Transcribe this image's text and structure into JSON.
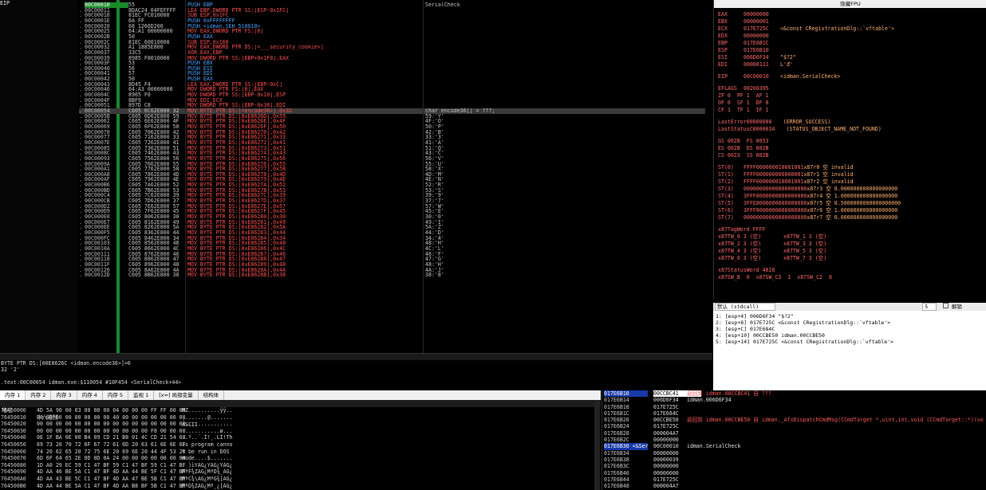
{
  "cpu": {
    "eip_label": "EIP",
    "rows": [
      {
        "addr": "00C00010",
        "hex": "55",
        "dis": "PUSH EBP",
        "cmt": "SerialCheck",
        "kind": "push",
        "sel": false,
        "cur": true
      },
      {
        "addr": "00C00011",
        "hex": "8DAC24 04FEFFFF",
        "dis": "LEA EBP,DWORD PTR SS:[ESP-0x1FC]",
        "cmt": "",
        "kind": "mov"
      },
      {
        "addr": "00C00018",
        "hex": "81EC FC010000",
        "dis": "SUB ESP,0x1FC",
        "cmt": "",
        "kind": "mov"
      },
      {
        "addr": "00C0001E",
        "hex": "6A FF",
        "dis": "PUSH 0xFFFFFFFF",
        "cmt": "",
        "kind": "push"
      },
      {
        "addr": "00C00020",
        "hex": "68 1266D200",
        "dis": "PUSH <idman.SEH_510010>",
        "cmt": "",
        "kind": "push"
      },
      {
        "addr": "00C00025",
        "hex": "64:A1 00000000",
        "dis": "MOV EAX,DWORD PTR FS:[0]",
        "cmt": "",
        "kind": "mov"
      },
      {
        "addr": "00C0002B",
        "hex": "50",
        "dis": "PUSH EAX",
        "cmt": "",
        "kind": "push"
      },
      {
        "addr": "00C0002C",
        "hex": "81EC 60010000",
        "dis": "SUB ESP,0x160",
        "cmt": "",
        "kind": "mov"
      },
      {
        "addr": "00C00032",
        "hex": "A1 1885E800",
        "dis": "MOV EAX,DWORD PTR DS:[<___security_cookie>]",
        "cmt": "",
        "kind": "mov"
      },
      {
        "addr": "00C00037",
        "hex": "33C5",
        "dis": "XOR EAX,EBP",
        "cmt": "",
        "kind": "mov"
      },
      {
        "addr": "00C00039",
        "hex": "8985 F8010000",
        "dis": "MOV DWORD PTR SS:[EBP+0x1F8],EAX",
        "cmt": "",
        "kind": "mov"
      },
      {
        "addr": "00C0003F",
        "hex": "53",
        "dis": "PUSH EBX",
        "cmt": "",
        "kind": "push"
      },
      {
        "addr": "00C00040",
        "hex": "56",
        "dis": "PUSH ESI",
        "cmt": "",
        "kind": "push"
      },
      {
        "addr": "00C00041",
        "hex": "57",
        "dis": "PUSH EDI",
        "cmt": "",
        "kind": "push"
      },
      {
        "addr": "00C00042",
        "hex": "50",
        "dis": "PUSH EAX",
        "cmt": "",
        "kind": "push"
      },
      {
        "addr": "00C00043",
        "hex": "8D45 F4",
        "dis": "LEA EAX,DWORD PTR SS:[EBP-0xC]",
        "cmt": "",
        "kind": "mov"
      },
      {
        "addr": "00C00046",
        "hex": "64:A3 00000000",
        "dis": "MOV DWORD PTR FS:[0],EAX",
        "cmt": "",
        "kind": "mov"
      },
      {
        "addr": "00C0004C",
        "hex": "8965 F0",
        "dis": "MOV DWORD PTR SS:[EBP-0x10],ESP",
        "cmt": "",
        "kind": "mov"
      },
      {
        "addr": "00C0004F",
        "hex": "8BF9",
        "dis": "MOV EDI,ECX",
        "cmt": "",
        "kind": "mov"
      },
      {
        "addr": "00C00051",
        "hex": "897D C8",
        "dis": "MOV DWORD PTR SS:[EBP-0x38],EDI",
        "cmt": "",
        "kind": "mov"
      },
      {
        "addr": "00C00054",
        "hex": "C605 6C62E800 32",
        "dis": "MOV BYTE PTR DS:[<encode36>],0x32",
        "cmt": "char encode36[] = ???;",
        "kind": "mov",
        "sel": true
      },
      {
        "addr": "00C0005B",
        "hex": "C605 6D62E800 59",
        "dis": "MOV BYTE PTR DS:[0xE8626D],0x59",
        "cmt": "59:'Y'",
        "kind": "mov"
      },
      {
        "addr": "00C00062",
        "hex": "C605 6E62E800 4F",
        "dis": "MOV BYTE PTR DS:[0xE8626E],0x4F",
        "cmt": "4F:'O'",
        "kind": "mov"
      },
      {
        "addr": "00C00069",
        "hex": "C605 6F62E800 50",
        "dis": "MOV BYTE PTR DS:[0xE8626F],0x50",
        "cmt": "50:'P'",
        "kind": "mov"
      },
      {
        "addr": "00C00070",
        "hex": "C605 7062E800 42",
        "dis": "MOV BYTE PTR DS:[0xE86270],0x42",
        "cmt": "42:'B'",
        "kind": "mov"
      },
      {
        "addr": "00C00077",
        "hex": "C605 7162E800 33",
        "dis": "MOV BYTE PTR DS:[0xE86271],0x33",
        "cmt": "33:'3'",
        "kind": "mov"
      },
      {
        "addr": "00C0007E",
        "hex": "C605 7262E800 41",
        "dis": "MOV BYTE PTR DS:[0xE86272],0x41",
        "cmt": "41:'A'",
        "kind": "mov"
      },
      {
        "addr": "00C00085",
        "hex": "C605 7362E800 51",
        "dis": "MOV BYTE PTR DS:[0xE86273],0x51",
        "cmt": "51:'Q'",
        "kind": "mov"
      },
      {
        "addr": "00C0008C",
        "hex": "C605 7462E800 43",
        "dis": "MOV BYTE PTR DS:[0xE86274],0x43",
        "cmt": "43:'C'",
        "kind": "mov"
      },
      {
        "addr": "00C00093",
        "hex": "C605 7562E800 56",
        "dis": "MOV BYTE PTR DS:[0xE86275],0x56",
        "cmt": "56:'V'",
        "kind": "mov"
      },
      {
        "addr": "00C0009A",
        "hex": "C605 7662E800 55",
        "dis": "MOV BYTE PTR DS:[0xE86276],0x55",
        "cmt": "55:'U'",
        "kind": "mov"
      },
      {
        "addr": "00C000A1",
        "hex": "C605 7762E800 58",
        "dis": "MOV BYTE PTR DS:[0xE86277],0x58",
        "cmt": "58:'X'",
        "kind": "mov"
      },
      {
        "addr": "00C000A8",
        "hex": "C605 7862E800 4D",
        "dis": "MOV BYTE PTR DS:[0xE86278],0x4D",
        "cmt": "4D:'M'",
        "kind": "mov"
      },
      {
        "addr": "00C000AF",
        "hex": "C605 7962E800 4E",
        "dis": "MOV BYTE PTR DS:[0xE86279],0x4E",
        "cmt": "4E:'N'",
        "kind": "mov"
      },
      {
        "addr": "00C000B6",
        "hex": "C605 7A62E800 52",
        "dis": "MOV BYTE PTR DS:[0xE8627A],0x52",
        "cmt": "52:'R'",
        "kind": "mov"
      },
      {
        "addr": "00C000BD",
        "hex": "C605 7B62E800 53",
        "dis": "MOV BYTE PTR DS:[0xE8627B],0x53",
        "cmt": "53:'S'",
        "kind": "mov"
      },
      {
        "addr": "00C000C4",
        "hex": "C605 7C62E800 39",
        "dis": "MOV BYTE PTR DS:[0xE8627C],0x39",
        "cmt": "39:'9'",
        "kind": "mov"
      },
      {
        "addr": "00C000CB",
        "hex": "C605 7D62E800 37",
        "dis": "MOV BYTE PTR DS:[0xE8627D],0x37",
        "cmt": "37:'7'",
        "kind": "mov"
      },
      {
        "addr": "00C000D2",
        "hex": "C605 7E62E800 57",
        "dis": "MOV BYTE PTR DS:[0xE8627E],0x57",
        "cmt": "57:'W'",
        "kind": "mov"
      },
      {
        "addr": "00C000D9",
        "hex": "C605 7F62E800 45",
        "dis": "MOV BYTE PTR DS:[0xE8627F],0x45",
        "cmt": "45:'E'",
        "kind": "mov"
      },
      {
        "addr": "00C000E0",
        "hex": "C605 8062E800 30",
        "dis": "MOV BYTE PTR DS:[0xE86280],0x30",
        "cmt": "30:'0'",
        "kind": "mov"
      },
      {
        "addr": "00C000E7",
        "hex": "C605 8162E800 49",
        "dis": "MOV BYTE PTR DS:[0xE86281],0x49",
        "cmt": "49:'I'",
        "kind": "mov"
      },
      {
        "addr": "00C000EE",
        "hex": "C605 8262E800 5A",
        "dis": "MOV BYTE PTR DS:[0xE86282],0x5A",
        "cmt": "5A:'Z'",
        "kind": "mov"
      },
      {
        "addr": "00C000F5",
        "hex": "C605 8362E800 44",
        "dis": "MOV BYTE PTR DS:[0xE86283],0x44",
        "cmt": "44:'D'",
        "kind": "mov"
      },
      {
        "addr": "00C000FC",
        "hex": "C605 8462E800 34",
        "dis": "MOV BYTE PTR DS:[0xE86284],0x34",
        "cmt": "34:'4'",
        "kind": "mov"
      },
      {
        "addr": "00C00103",
        "hex": "C605 8562E800 48",
        "dis": "MOV BYTE PTR DS:[0xE86285],0x48",
        "cmt": "48:'H'",
        "kind": "mov"
      },
      {
        "addr": "00C0010A",
        "hex": "C605 8662E800 4C",
        "dis": "MOV BYTE PTR DS:[0xE86286],0x4C",
        "cmt": "4C:'L'",
        "kind": "mov"
      },
      {
        "addr": "00C00111",
        "hex": "C605 8762E800 46",
        "dis": "MOV BYTE PTR DS:[0xE86287],0x46",
        "cmt": "46:'F'",
        "kind": "mov"
      },
      {
        "addr": "00C00118",
        "hex": "C605 8862E800 47",
        "dis": "MOV BYTE PTR DS:[0xE86288],0x47",
        "cmt": "47:'G'",
        "kind": "mov"
      },
      {
        "addr": "00C0011F",
        "hex": "C605 8962E800 48",
        "dis": "MOV BYTE PTR DS:[0xE86289],0x48",
        "cmt": "48:'H'",
        "kind": "mov"
      },
      {
        "addr": "00C00126",
        "hex": "C605 8A62E800 4A",
        "dis": "MOV BYTE PTR DS:[0xE8628A],0x4A",
        "cmt": "4A:'J'",
        "kind": "mov"
      },
      {
        "addr": "00C0012D",
        "hex": "C605 8B62E800 38",
        "dis": "MOV BYTE PTR DS:[0xE8628B],0x38",
        "cmt": "38:'8'",
        "kind": "mov"
      }
    ]
  },
  "info": {
    "lines": [
      "BYTE PTR DS:[00E8626C <idman.encode36>]=0",
      "32 '2'",
      "",
      ".text:00C00054 idman.exe:$110054 #10F454 <SerialCheck+44>"
    ]
  },
  "registers": {
    "title": "隐藏FPU",
    "lines": [
      {
        "n": "EAX",
        "v": "00000000",
        "c": ""
      },
      {
        "n": "EBX",
        "v": "00000001",
        "c": ""
      },
      {
        "n": "ECX",
        "v": "017E725C",
        "c": "<&const CRegistrationDlg::`vftable'>"
      },
      {
        "n": "EDX",
        "v": "00000000",
        "c": ""
      },
      {
        "n": "EBP",
        "v": "017E6B1C",
        "c": ""
      },
      {
        "n": "ESP",
        "v": "017E6B10",
        "c": ""
      },
      {
        "n": "ESI",
        "v": "006D6F34",
        "c": "\"$?2\""
      },
      {
        "n": "EDI",
        "v": "00000111",
        "c": "L'đ'"
      },
      {
        "sp": true
      },
      {
        "n": "EIP",
        "v": "00C00010",
        "c": "<idman.SerialCheck>"
      },
      {
        "sp": true
      },
      {
        "n": "EFLAGS",
        "v": "00200395",
        "c": ""
      },
      {
        "n": "ZF 0  PF 1  AF 1",
        "v": "",
        "c": ""
      },
      {
        "n": "OF 0  SF 1  DF 0",
        "v": "",
        "c": ""
      },
      {
        "n": "CF 1  TF 1  IF 1",
        "v": "",
        "c": ""
      },
      {
        "sp": true
      },
      {
        "n": "LastError",
        "v": "00000000",
        "c": "(ERROR_SUCCESS)"
      },
      {
        "n": "LastStatus",
        "v": "C0000034",
        "c": "(STATUS_OBJECT_NAME_NOT_FOUND)"
      },
      {
        "sp": true
      },
      {
        "n": "GS 002B  FS 0053",
        "v": "",
        "c": ""
      },
      {
        "n": "ES 002B  DS 002B",
        "v": "",
        "c": ""
      },
      {
        "n": "CS 0023  SS 002B",
        "v": "",
        "c": ""
      },
      {
        "sp": true
      },
      {
        "n": "ST(0)",
        "v": "FFFF000000010001001",
        "c": "x87r0 空 invalid"
      },
      {
        "n": "ST(1)",
        "v": "FFFF000000000000001",
        "c": "x87r1 空 invalid"
      },
      {
        "n": "ST(2)",
        "v": "FFFF000000010001001",
        "c": "x87r2 空 invalid"
      },
      {
        "n": "ST(3)",
        "v": "00000000000000000000",
        "c": "x87r3 空 0.000000000000000000"
      },
      {
        "n": "ST(4)",
        "v": "3FFF8000000000000000",
        "c": "x87r4 空 1.000000000000000000"
      },
      {
        "n": "ST(5)",
        "v": "3FFE8000000000000000",
        "c": "x87r5 空 0.5000000000000000000"
      },
      {
        "n": "ST(6)",
        "v": "3FFF8000000000000000",
        "c": "x87r6 空 1.000000000000000000"
      },
      {
        "n": "ST(7)",
        "v": "00000000000000000000",
        "c": "x87r7 空 0.000000000000000000"
      },
      {
        "sp": true
      },
      {
        "n": "x87TagWord FFFF",
        "v": "",
        "c": ""
      },
      {
        "n": "x87TW_0 3 (空)       x87TW_1 3 (空)",
        "v": "",
        "c": ""
      },
      {
        "n": "x87TW_2 3 (空)       x87TW_3 3 (空)",
        "v": "",
        "c": ""
      },
      {
        "n": "x87TW_4 3 (空)       x87TW_5 3 (空)",
        "v": "",
        "c": ""
      },
      {
        "n": "x87TW_6 3 (空)       x87TW_7 3 (空)",
        "v": "",
        "c": ""
      },
      {
        "sp": true
      },
      {
        "n": "x87StatusWord 4020",
        "v": "",
        "c": ""
      },
      {
        "n": "x87SW_B  0  x87SW_C3  1  x87SW_C2  0",
        "v": "",
        "c": ""
      }
    ]
  },
  "stack_args": {
    "callconv": "默认 (stdcall)",
    "count": "5",
    "unlock_label": "解锁",
    "rows": [
      "1: [esp+4] 006D6F34 \"$?2\"",
      "2: [esp+8] 017E725C <&const CRegistrationDlg::`vftable'>",
      "3: [esp+C] 017E684C",
      "4: [esp+10] 00CCBE50 idman.00CCBE50",
      "5: [esp+14] 017E725C <&const CRegistrationDlg::`vftable'>"
    ]
  },
  "dump_tabs": [
    "内存 1",
    "内存 2",
    "内存 3",
    "内存 4",
    "内存 5",
    "监视 1",
    "[x=] 局部变量",
    "结构体"
  ],
  "dump": {
    "header": {
      "addr": "地址",
      "hex": "十六进制",
      "ascii": "ASCII"
    },
    "rows": [
      {
        "a": "76450000",
        "h": "4D 5A 90 00 03 00 00 00 04 00 00 00 FF FF 00 00",
        "s": "MZ..........ÿÿ.."
      },
      {
        "a": "76450010",
        "h": "B8 00 00 00 00 00 00 00 40 00 00 00 00 00 00 00",
        "s": "¸.......@......."
      },
      {
        "a": "76450020",
        "h": "00 00 00 00 00 00 00 00 00 00 00 00 00 00 00 00",
        "s": "................"
      },
      {
        "a": "76450030",
        "h": "00 00 00 00 00 00 00 00 00 00 00 00 F8 00 00 00",
        "s": "............ø..."
      },
      {
        "a": "76450040",
        "h": "0E 1F BA 0E 00 B4 09 CD 21 B8 01 4C CD 21 54 68",
        "s": "..º..´.Í!¸.LÍ!Th"
      },
      {
        "a": "76450050",
        "h": "69 73 20 70 72 6F 67 72 61 6D 20 63 61 6E 6E 6F",
        "s": "is program canno"
      },
      {
        "a": "76450060",
        "h": "74 20 62 65 20 72 75 6E 20 69 6E 20 44 4F 53 20",
        "s": "t be run in DOS "
      },
      {
        "a": "76450070",
        "h": "6D 6F 64 65 2E 0D 0D 0A 24 00 00 00 00 00 00 00",
        "s": "mode....$......."
      },
      {
        "a": "76450080",
        "h": "1D A0 29 EC 59 C1 47 BF 59 C1 47 BF 59 C1 47 BF",
        "s": ". )ìYÁG¿YÁG¿YÁG¿"
      },
      {
        "a": "76450090",
        "h": "4D AA 46 BE 5A C1 47 BF 4D AA 44 BE 5F C1 47 BF",
        "s": "MªF¾ZÁG¿MªD¾_ÁG¿"
      },
      {
        "a": "764500A0",
        "h": "4D AA 43 BE 5C C1 47 BF 4D AA 47 BE 5B C1 47 BF",
        "s": "MªC¾\\ÁG¿MªG¾[ÁG¿"
      },
      {
        "a": "764500B0",
        "h": "4D AA 44 BE 5A C1 47 BF 4D AA B8 BF 5B C1 47 BF",
        "s": "MªD¾ZÁG¿Mª¸¿[ÁG¿"
      }
    ]
  },
  "stack": {
    "rows": [
      {
        "a": "017E6B10",
        "v": "00CCBC41",
        "c": "返回到 idman.00CCBC41 自 ???",
        "hl": true,
        "red": true
      },
      {
        "a": "017E6B14",
        "v": "006D6F34",
        "c": "idman.006D6F34",
        "white": true
      },
      {
        "a": "017E6B18",
        "v": "017E725C",
        "c": ""
      },
      {
        "a": "017E6B1C",
        "v": "017E684C",
        "c": ""
      },
      {
        "a": "017E6B20",
        "v": "00CCBE50",
        "c": "返回到 idman.00CCBE50 自 idman._AfxDispatchCmdMsg(CCmdTarget *,uint,int,void (CCmdTarget::*)(vo",
        "red": true
      },
      {
        "a": "017E6B24",
        "v": "017E725C",
        "c": ""
      },
      {
        "a": "017E6B28",
        "v": "000004A7",
        "c": ""
      },
      {
        "a": "017E6B2C",
        "v": "00000000",
        "c": ""
      },
      {
        "a": "017E6B30 <&Ser",
        "v": "00C00010",
        "c": "idman.SerialCheck",
        "white": true,
        "addrhl": true
      },
      {
        "a": "017E6B34",
        "v": "00000000",
        "c": ""
      },
      {
        "a": "017E6B38",
        "v": "00000039",
        "c": ""
      },
      {
        "a": "017E6B3C",
        "v": "00000000",
        "c": ""
      },
      {
        "a": "017E6B40",
        "v": "00000000",
        "c": ""
      },
      {
        "a": "017E6B44",
        "v": "017E725C",
        "c": ""
      },
      {
        "a": "017E6B48",
        "v": "000004A7",
        "c": ""
      }
    ]
  },
  "colors": {
    "accent": "#1a8a2a",
    "push": "#4aa3ff",
    "mov": "#ff5050",
    "selected": "#3a3a3a",
    "stack_highlight": "#173aa8"
  }
}
